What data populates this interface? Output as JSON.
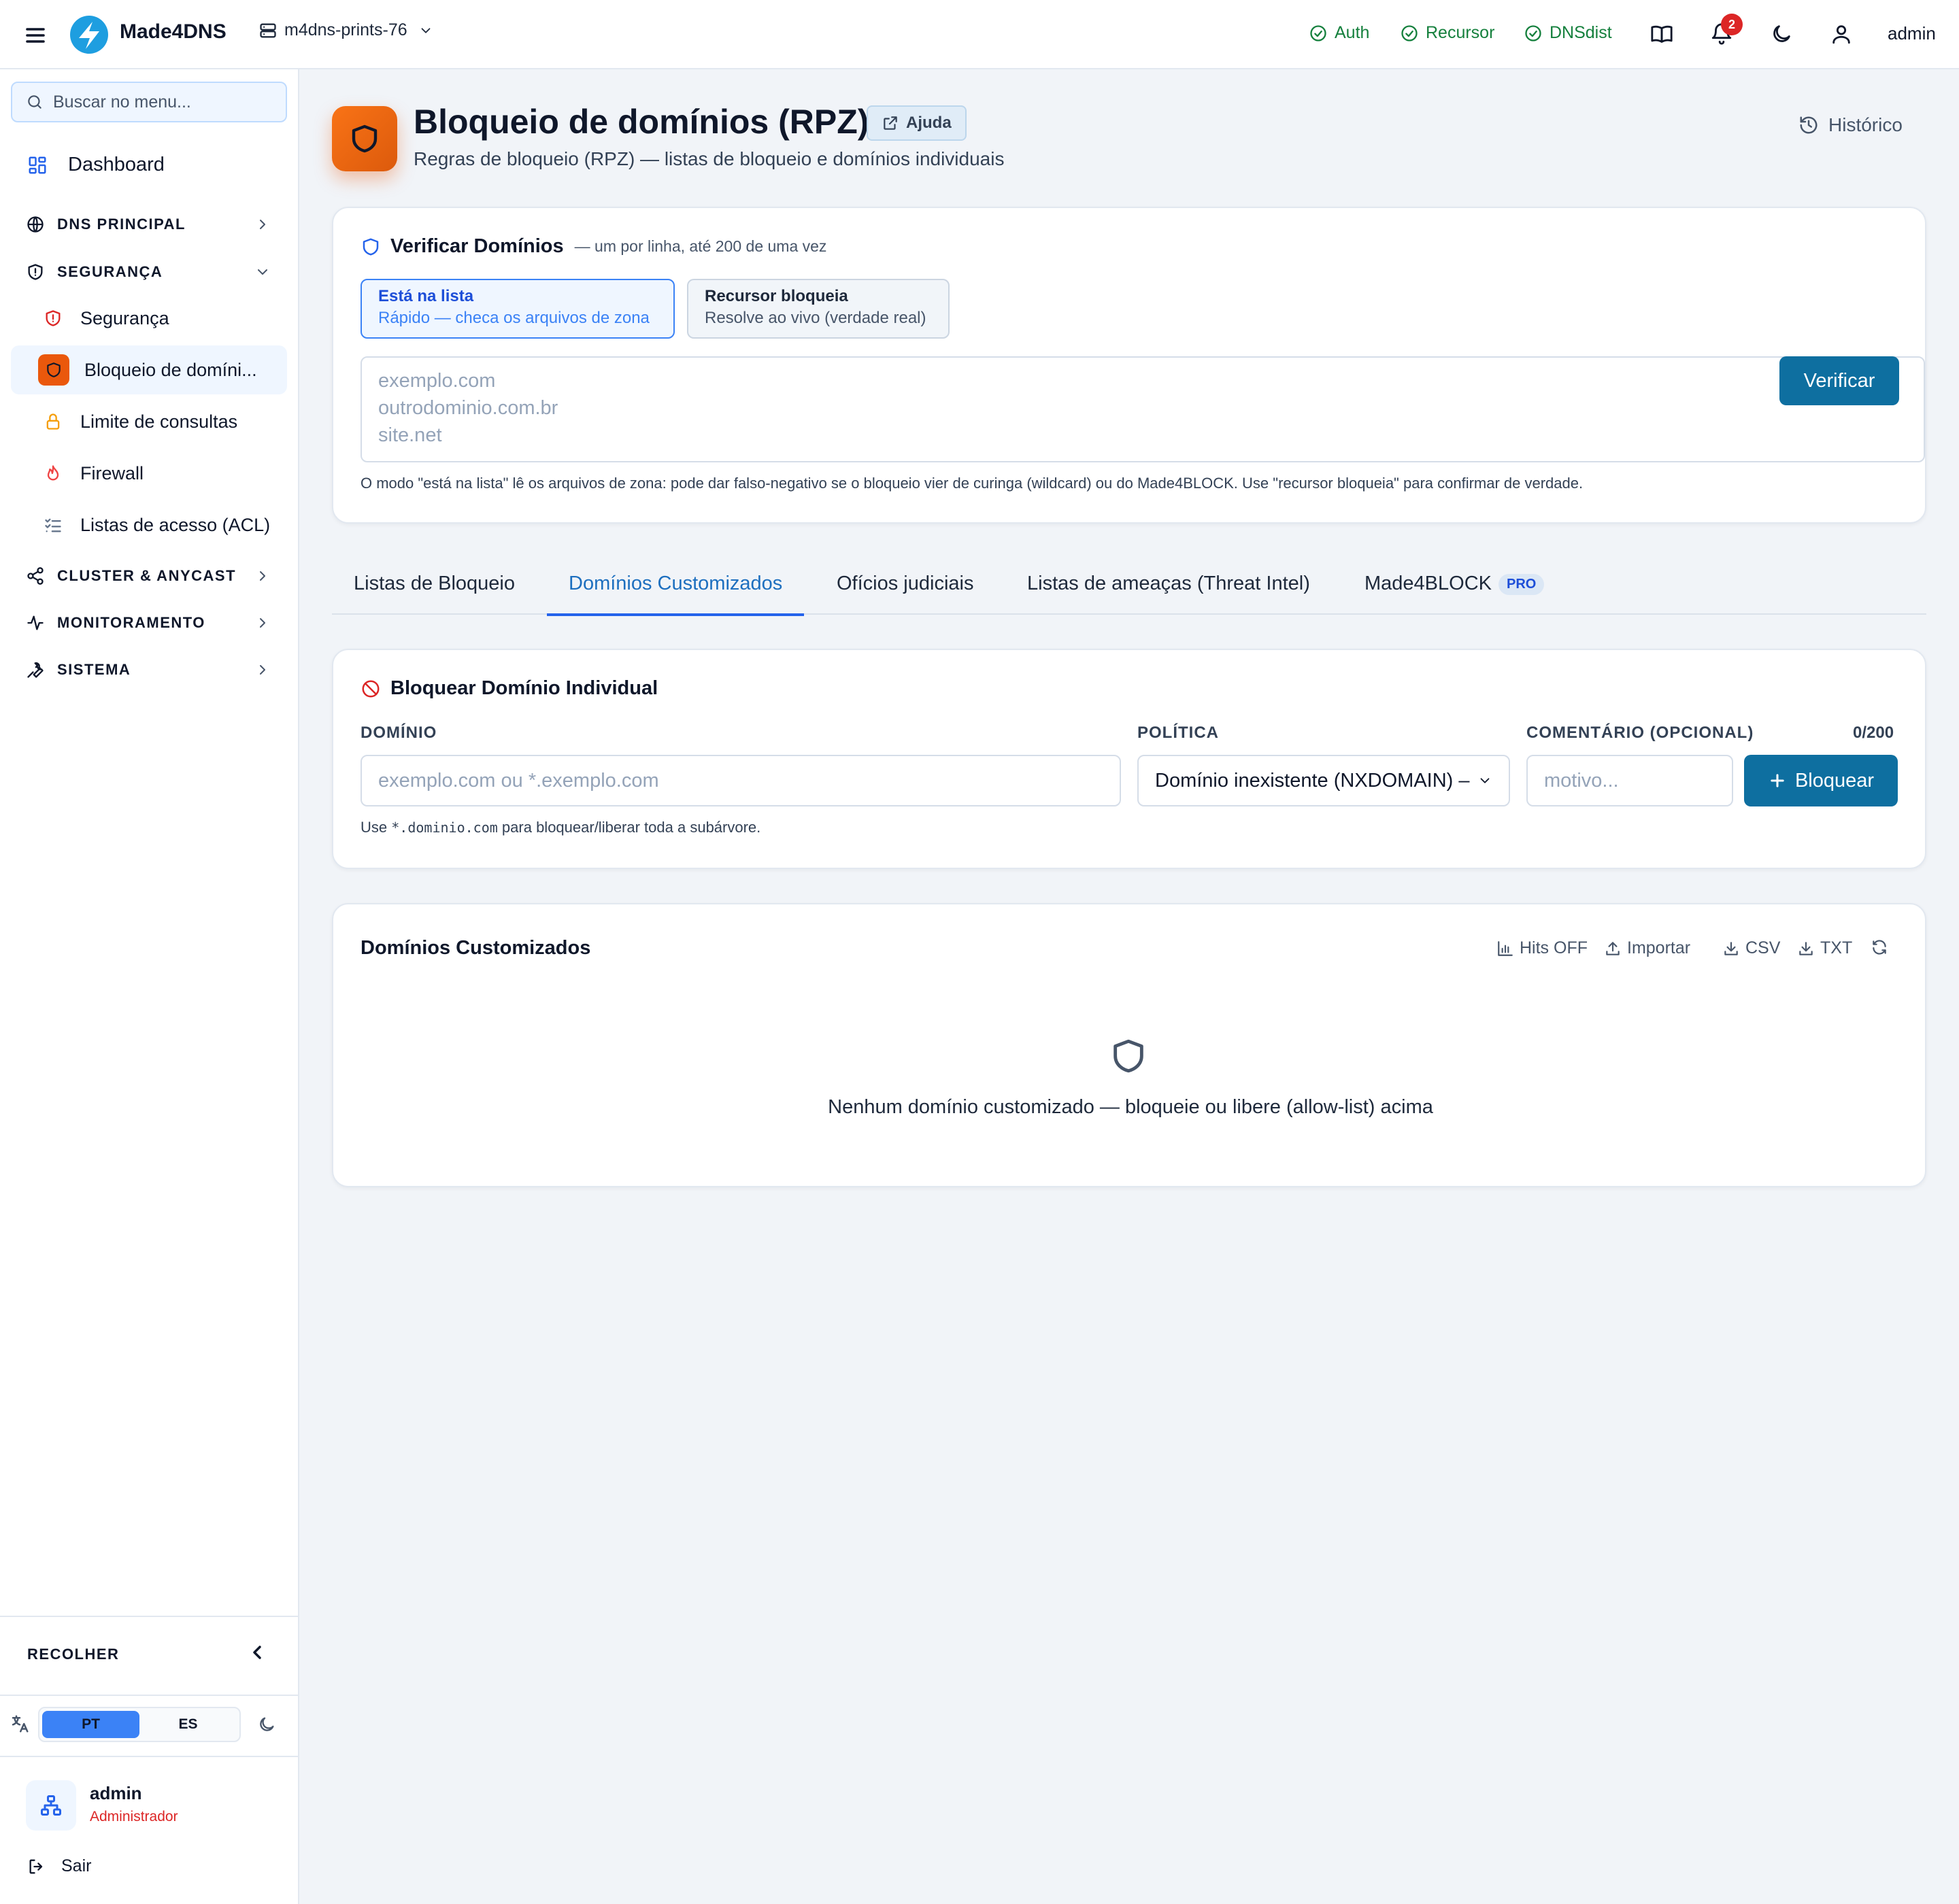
{
  "topbar": {
    "brand": "Made4DNS",
    "server": "m4dns-prints-76",
    "services": [
      {
        "label": "Auth"
      },
      {
        "label": "Recursor"
      },
      {
        "label": "DNSdist"
      }
    ],
    "notification_count": "2",
    "user": "admin"
  },
  "sidebar": {
    "search_placeholder": "Buscar no menu...",
    "dashboard": "Dashboard",
    "sections": {
      "dns_principal": "DNS PRINCIPAL",
      "seguranca": "SEGURANÇA",
      "cluster": "CLUSTER & ANYCAST",
      "monitoramento": "MONITORAMENTO",
      "sistema": "SISTEMA"
    },
    "seguranca_items": [
      {
        "label": "Segurança"
      },
      {
        "label": "Bloqueio de domíni..."
      },
      {
        "label": "Limite de consultas"
      },
      {
        "label": "Firewall"
      },
      {
        "label": "Listas de acesso (ACL)"
      }
    ],
    "collapse_label": "RECOLHER",
    "languages": [
      "PT",
      "ES"
    ],
    "active_language": "PT",
    "user_name": "admin",
    "user_role": "Administrador",
    "logout": "Sair"
  },
  "header": {
    "title": "Bloqueio de domínios (RPZ)",
    "help_label": "Ajuda",
    "subtitle": "Regras de bloqueio (RPZ) — listas de bloqueio e domínios individuais",
    "history_label": "Histórico"
  },
  "verify": {
    "title": "Verificar Domínios",
    "hint": "— um por linha, até 200 de uma vez",
    "mode_list_title": "Está na lista",
    "mode_list_desc": "Rápido — checa os arquivos de zona",
    "mode_resolver_title": "Recursor bloqueia",
    "mode_resolver_desc": "Resolve ao vivo (verdade real)",
    "placeholder": "exemplo.com\noutrodominio.com.br\nsite.net",
    "button": "Verificar",
    "note": "O modo \"está na lista\" lê os arquivos de zona: pode dar falso-negativo se o bloqueio vier de curinga (wildcard) ou do Made4BLOCK. Use \"recursor bloqueia\" para confirmar de verdade."
  },
  "tabs": [
    {
      "label": "Listas de Bloqueio"
    },
    {
      "label": "Domínios Customizados"
    },
    {
      "label": "Ofícios judiciais"
    },
    {
      "label": "Listas de ameaças (Threat Intel)"
    },
    {
      "label": "Made4BLOCK"
    }
  ],
  "pro_badge": "PRO",
  "active_tab": "Domínios Customizados",
  "block_form": {
    "title": "Bloquear Domínio Individual",
    "domain_label": "DOMÍNIO",
    "domain_placeholder": "exemplo.com ou *.exemplo.com",
    "policy_label": "POLÍTICA",
    "policy_value": "Domínio inexistente (NXDOMAIN) –",
    "comment_label": "COMENTÁRIO (OPCIONAL)",
    "comment_counter": "0/200",
    "comment_placeholder": "motivo...",
    "button": "Bloquear",
    "hint_prefix": "Use",
    "hint_code": "*.dominio.com",
    "hint_suffix": "para bloquear/liberar toda a subárvore."
  },
  "custom_domains": {
    "title": "Domínios Customizados",
    "tools": {
      "hits": "Hits OFF",
      "import": "Importar",
      "csv": "CSV",
      "txt": "TXT"
    },
    "empty_message": "Nenhum domínio customizado — bloqueie ou libere (allow-list) acima"
  },
  "colors": {
    "primary": "#0e6fa0",
    "accent_orange": "#ea580c",
    "ok_green": "#15803d",
    "danger": "#dc2626",
    "link_blue": "#2563eb"
  }
}
